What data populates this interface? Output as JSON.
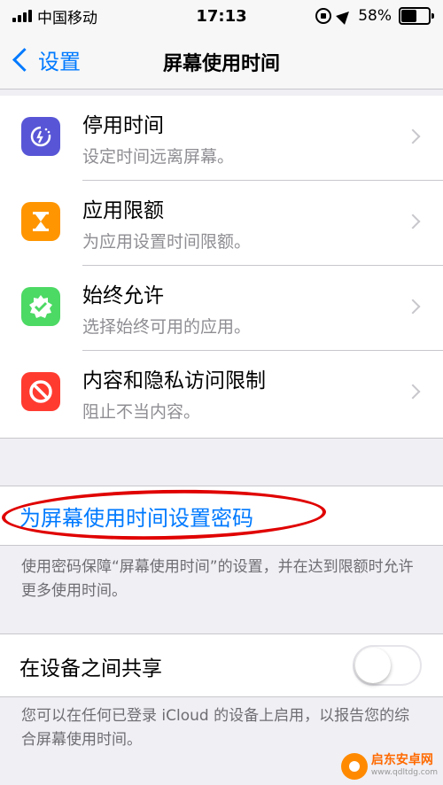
{
  "status_bar": {
    "carrier": "中国移动",
    "time": "17:13",
    "battery_percent": "58%",
    "battery_level": 0.58
  },
  "nav": {
    "back_label": "设置",
    "title": "屏幕使用时间"
  },
  "settings": [
    {
      "title": "停用时间",
      "subtitle": "设定时间远离屏幕。",
      "icon": "downtime-icon",
      "color": "#5856d6"
    },
    {
      "title": "应用限额",
      "subtitle": "为应用设置时间限额。",
      "icon": "hourglass-icon",
      "color": "#ff9500"
    },
    {
      "title": "始终允许",
      "subtitle": "选择始终可用的应用。",
      "icon": "checkmark-badge-icon",
      "color": "#4cd964"
    },
    {
      "title": "内容和隐私访问限制",
      "subtitle": "阻止不当内容。",
      "icon": "restriction-icon",
      "color": "#ff3b30"
    }
  ],
  "passcode": {
    "link": "为屏幕使用时间设置密码",
    "footnote": "使用密码保障“屏幕使用时间”的设置，并在达到限额时允许更多使用时间。"
  },
  "share": {
    "label": "在设备之间共享",
    "enabled": false,
    "footnote": "您可以在任何已登录 iCloud 的设备上启用，以报告您的综合屏幕使用时间。"
  },
  "watermark": {
    "name": "启东安卓网",
    "url": "www.qdltdg.com"
  },
  "accent_color": "#007aff",
  "annotation_color": "#e00000"
}
